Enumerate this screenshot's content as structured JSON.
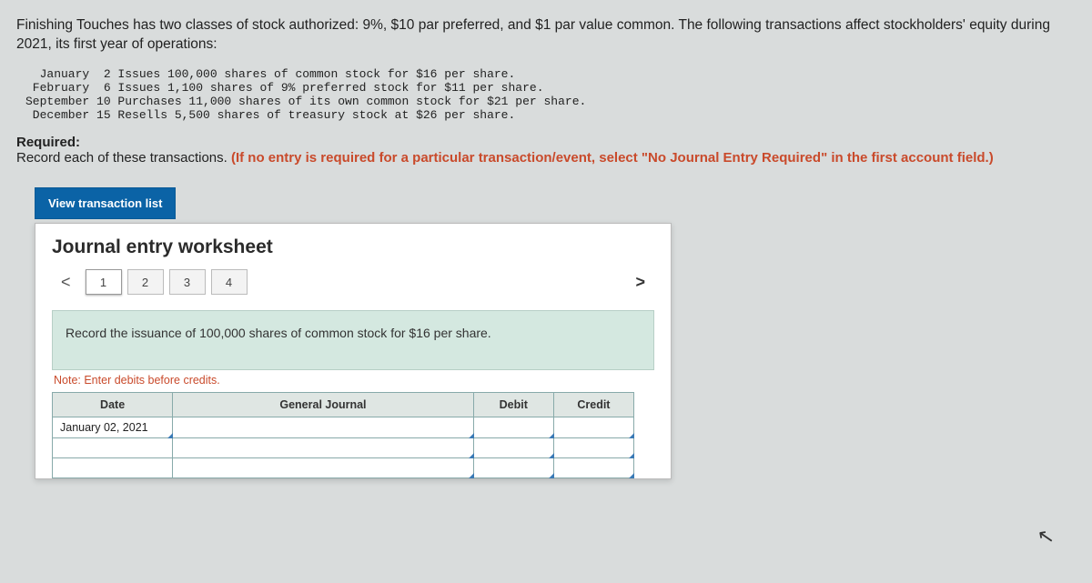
{
  "intro": "Finishing Touches has two classes of stock authorized: 9%, $10 par preferred, and $1 par value common. The following transactions affect stockholders' equity during 2021, its first year of operations:",
  "transactions": "  January  2 Issues 100,000 shares of common stock for $16 per share.\n February  6 Issues 1,100 shares of 9% preferred stock for $11 per share.\nSeptember 10 Purchases 11,000 shares of its own common stock for $21 per share.\n December 15 Resells 5,500 shares of treasury stock at $26 per share.",
  "required": {
    "label": "Required:",
    "text": "Record each of these transactions. ",
    "note": "(If no entry is required for a particular transaction/event, select \"No Journal Entry Required\" in the first account field.)"
  },
  "view_btn": "View transaction list",
  "worksheet": {
    "title": "Journal entry worksheet",
    "pages": [
      "1",
      "2",
      "3",
      "4"
    ],
    "active_page": "1",
    "chev_left": "<",
    "chev_right": ">",
    "instruction": "Record the issuance of 100,000 shares of common stock for $16 per share.",
    "note": "Note: Enter debits before credits.",
    "headers": {
      "date": "Date",
      "gj": "General Journal",
      "debit": "Debit",
      "credit": "Credit"
    },
    "rows": [
      {
        "date": "January 02, 2021",
        "gj": "",
        "debit": "",
        "credit": ""
      },
      {
        "date": "",
        "gj": "",
        "debit": "",
        "credit": ""
      },
      {
        "date": "",
        "gj": "",
        "debit": "",
        "credit": ""
      }
    ]
  }
}
